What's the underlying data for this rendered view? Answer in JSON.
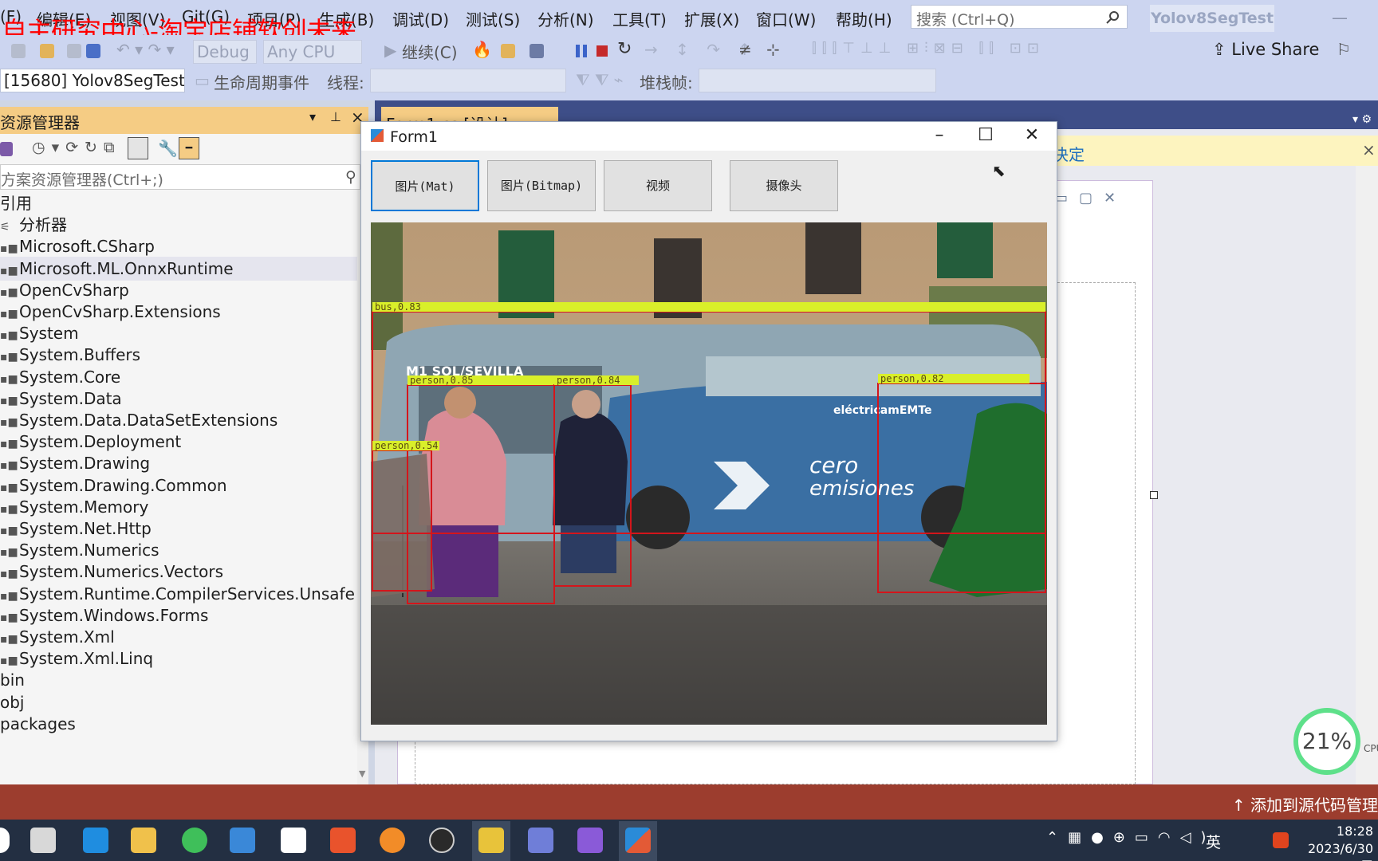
{
  "menu": {
    "items": [
      "(F)",
      "编辑(E)",
      "视图(V)",
      "Git(G)",
      "项目(P)",
      "生成(B)",
      "调试(D)",
      "测试(S)",
      "分析(N)",
      "工具(T)",
      "扩展(X)",
      "窗口(W)",
      "帮助(H)"
    ],
    "watermark": "自主研究中心-淘宝店铺软创未来",
    "search_placeholder": "搜索 (Ctrl+Q)",
    "solution_name": "Yolov8SegTest"
  },
  "toolbar": {
    "config": "Debug",
    "platform": "Any CPU",
    "continue": "继续(C)",
    "live_share": "Live Share",
    "process": "[15680] Yolov8SegTest.",
    "lifecycle": "生命周期事件",
    "thread_label": "线程:",
    "stackframe_label": "堆栈帧:"
  },
  "solution_explorer": {
    "title": "资源管理器",
    "search_placeholder": "方案资源管理器(Ctrl+;)",
    "items": [
      "引用",
      "分析器",
      "Microsoft.CSharp",
      "Microsoft.ML.OnnxRuntime",
      "OpenCvSharp",
      "OpenCvSharp.Extensions",
      "System",
      "System.Buffers",
      "System.Core",
      "System.Data",
      "System.Data.DataSetExtensions",
      "System.Deployment",
      "System.Drawing",
      "System.Drawing.Common",
      "System.Memory",
      "System.Net.Http",
      "System.Numerics",
      "System.Numerics.Vectors",
      "System.Runtime.CompilerServices.Unsafe",
      "System.Windows.Forms",
      "System.Xml",
      "System.Xml.Linq",
      "bin",
      "obj",
      "packages"
    ],
    "selected_index": 3
  },
  "editor": {
    "tab_label": "Form1.cs [设计]",
    "notify_text": "决定"
  },
  "form1": {
    "title": "Form1",
    "buttons": [
      "图片(Mat)",
      "图片(Bitmap)",
      "视频",
      "摄像头"
    ],
    "detections": [
      "bus,0.83",
      "person,0.85",
      "person,0.84",
      "person,0.82",
      "person,0.54"
    ],
    "bus_text": [
      "cero",
      "emisiones",
      "eléctricamEMTe"
    ],
    "bus_route": "M1 SOL/SEVILLA"
  },
  "cpu": "21%",
  "cpu_label": "CPU",
  "statusbar": {
    "text": "↑ 添加到源代码管理"
  },
  "taskbar": {
    "ime": "英",
    "time": "18:28",
    "date": "2023/6/30 周"
  },
  "colors": {
    "accent": "#ccd5f0",
    "status": "#9c3d2e",
    "panel_header": "#f5cc84",
    "detection_box": "#d4151b",
    "label_bg": "#d9ef2a"
  }
}
